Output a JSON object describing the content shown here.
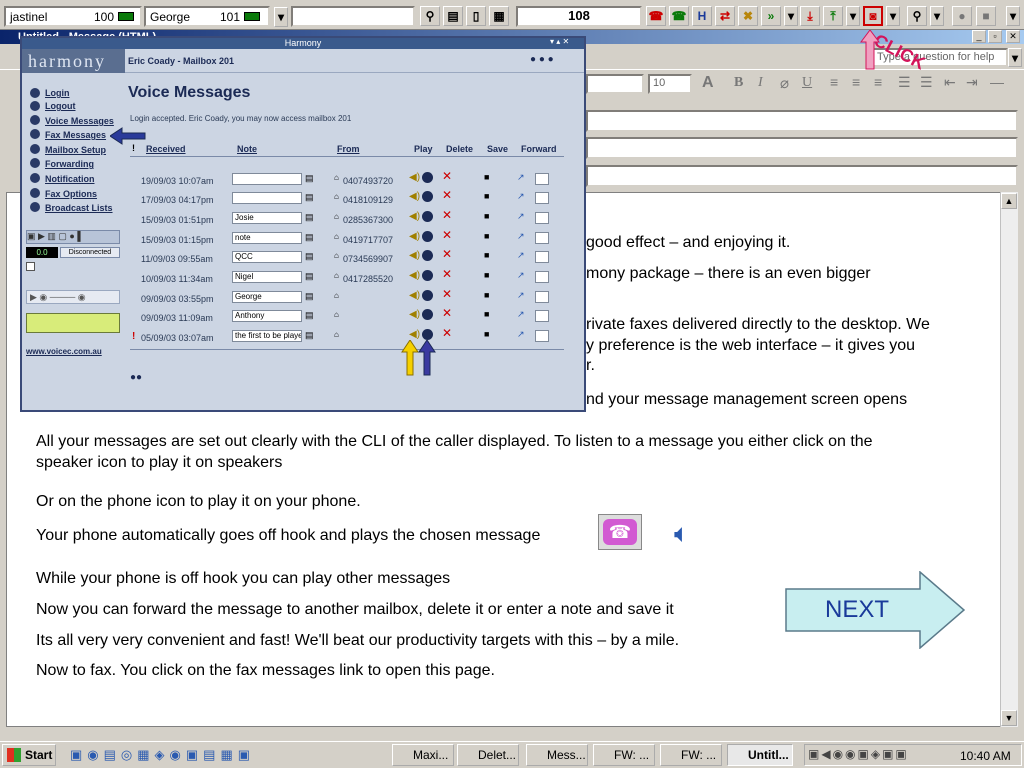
{
  "toolbar": {
    "agent1_name": "jastinel",
    "agent1_ext": "100",
    "agent2_name": "George",
    "agent2_ext": "101",
    "counter_value": "108",
    "help_placeholder": "Type a question for help",
    "click_label": "CLICK",
    "font_size_value": "10"
  },
  "document": {
    "title": "Untitled - Message (HTML)",
    "fragment_lines": [
      "good effect – and enjoying it.",
      "mony package – there is an even bigger",
      "rivate faxes delivered directly to the desktop. We",
      "y preference is the web interface – it gives you",
      "r.",
      "nd your message management screen opens"
    ],
    "paragraphs": [
      "All your messages are set out clearly with the CLI of the caller displayed. To listen to a message you either click on the",
      "speaker icon to play it on speakers",
      "Or on the phone icon to play it on your phone.",
      "Your phone automatically goes off hook and plays the chosen message",
      "While your phone is off hook you can play other messages",
      "Now you can forward the message to another mailbox, delete it or enter a note and save it",
      "Its all very very convenient and fast! We'll beat our productivity targets with this – by a mile.",
      "Now to fax. You click on the fax messages link to open this page."
    ],
    "next_label": "NEXT"
  },
  "harmony": {
    "window_title": "Harmony",
    "logo_text": "harmony",
    "header_title": "Eric Coady - Mailbox 201",
    "page_heading": "Voice Messages",
    "status_message": "Login accepted. Eric Coady, you may now access mailbox 201",
    "nav": [
      "Login",
      "Logout",
      "Voice Messages",
      "Fax Messages",
      "Mailbox Setup",
      "Forwarding",
      "Notification",
      "Fax Options",
      "Broadcast Lists"
    ],
    "player_readout": "0.0",
    "player_status": "Disconnected",
    "website": "www.voicec.com.au",
    "columns": {
      "received": "Received",
      "note": "Note",
      "from": "From",
      "play": "Play",
      "delete": "Delete",
      "save": "Save",
      "forward": "Forward",
      "urgent": "!"
    },
    "messages": [
      {
        "received": "19/09/03 10:07am",
        "note": "",
        "from": "0407493720",
        "urgent": ""
      },
      {
        "received": "17/09/03 04:17pm",
        "note": "",
        "from": "0418109129",
        "urgent": ""
      },
      {
        "received": "15/09/03 01:51pm",
        "note": "Josie",
        "from": "0285367300",
        "urgent": ""
      },
      {
        "received": "15/09/03 01:15pm",
        "note": "note",
        "from": "0419717707",
        "urgent": ""
      },
      {
        "received": "11/09/03 09:55am",
        "note": "QCC",
        "from": "0734569907",
        "urgent": ""
      },
      {
        "received": "10/09/03 11:34am",
        "note": "Nigel",
        "from": "0417285520",
        "urgent": ""
      },
      {
        "received": "09/09/03 03:55pm",
        "note": "George",
        "from": "",
        "urgent": ""
      },
      {
        "received": "09/09/03 11:09am",
        "note": "Anthony",
        "from": "",
        "urgent": ""
      },
      {
        "received": "05/09/03 03:07am",
        "note": "the first to be played",
        "from": "",
        "urgent": "!"
      }
    ]
  },
  "taskbar": {
    "start_label": "Start",
    "tasks": [
      "Maxi...",
      "Delet...",
      "Mess...",
      "FW: ...",
      "FW: ...",
      "Untitl..."
    ],
    "clock": "10:40 AM"
  },
  "colors": {
    "next_arrow": "#c8eef0",
    "next_text": "#1a3a9a",
    "click_text": "#d4145a",
    "accent_navy": "#1b2a55"
  }
}
